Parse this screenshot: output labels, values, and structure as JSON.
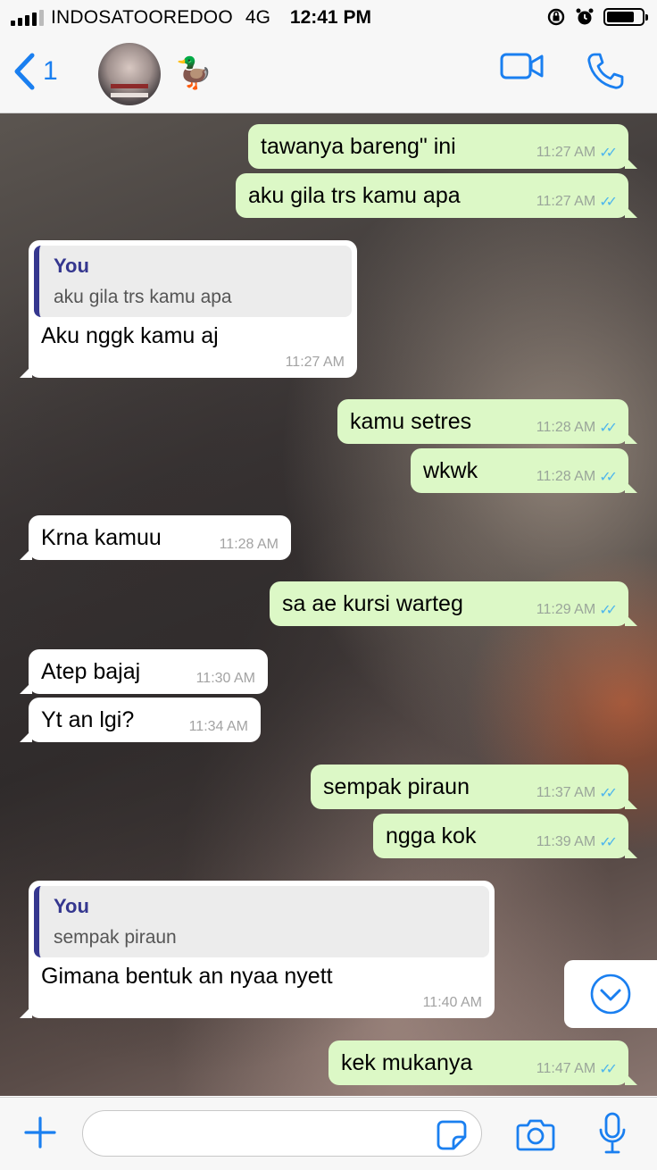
{
  "status_bar": {
    "carrier": "INDOSATOOREDOO",
    "network": "4G",
    "time": "12:41 PM",
    "battery_level": 0.8
  },
  "header": {
    "back_count": "1",
    "contact_name": "🦆",
    "icons": [
      "video-call-icon",
      "voice-call-icon"
    ]
  },
  "accent_colors": {
    "ios_blue": "#1a7ff0",
    "outgoing_bubble": "#dcf8c6",
    "incoming_bubble": "#ffffff",
    "read_ticks": "#4fb6ec",
    "quote_author": "#35378f"
  },
  "messages": [
    {
      "dir": "out",
      "text": "tawanya  bareng\" ini",
      "time": "11:27 AM"
    },
    {
      "dir": "out",
      "text": "aku gila trs kamu apa",
      "time": "11:27 AM"
    },
    {
      "dir": "in",
      "quote_author": "You",
      "quote_text": "aku gila trs kamu apa",
      "text": "Aku nggk kamu aj",
      "time": "11:27 AM"
    },
    {
      "dir": "out",
      "text": "kamu setres",
      "time": "11:28 AM"
    },
    {
      "dir": "out",
      "text": "wkwk",
      "time": "11:28 AM"
    },
    {
      "dir": "in",
      "text": "Krna kamuu",
      "time": "11:28 AM"
    },
    {
      "dir": "out",
      "text": "sa ae kursi warteg",
      "time": "11:29 AM"
    },
    {
      "dir": "in",
      "text": "Atep bajaj",
      "time": "11:30 AM"
    },
    {
      "dir": "in",
      "text": "Yt an lgi?",
      "time": "11:34 AM"
    },
    {
      "dir": "out",
      "text": "sempak piraun",
      "time": "11:37 AM"
    },
    {
      "dir": "out",
      "text": "ngga kok",
      "time": "11:39 AM"
    },
    {
      "dir": "in",
      "quote_author": "You",
      "quote_text": "sempak piraun",
      "text": "Gimana bentuk an nyaa nyett",
      "time": "11:40 AM"
    },
    {
      "dir": "out",
      "text": "kek mukanya",
      "time": "11:47 AM"
    }
  ],
  "read_ticks": "✓✓",
  "input": {
    "value": "",
    "placeholder": ""
  }
}
